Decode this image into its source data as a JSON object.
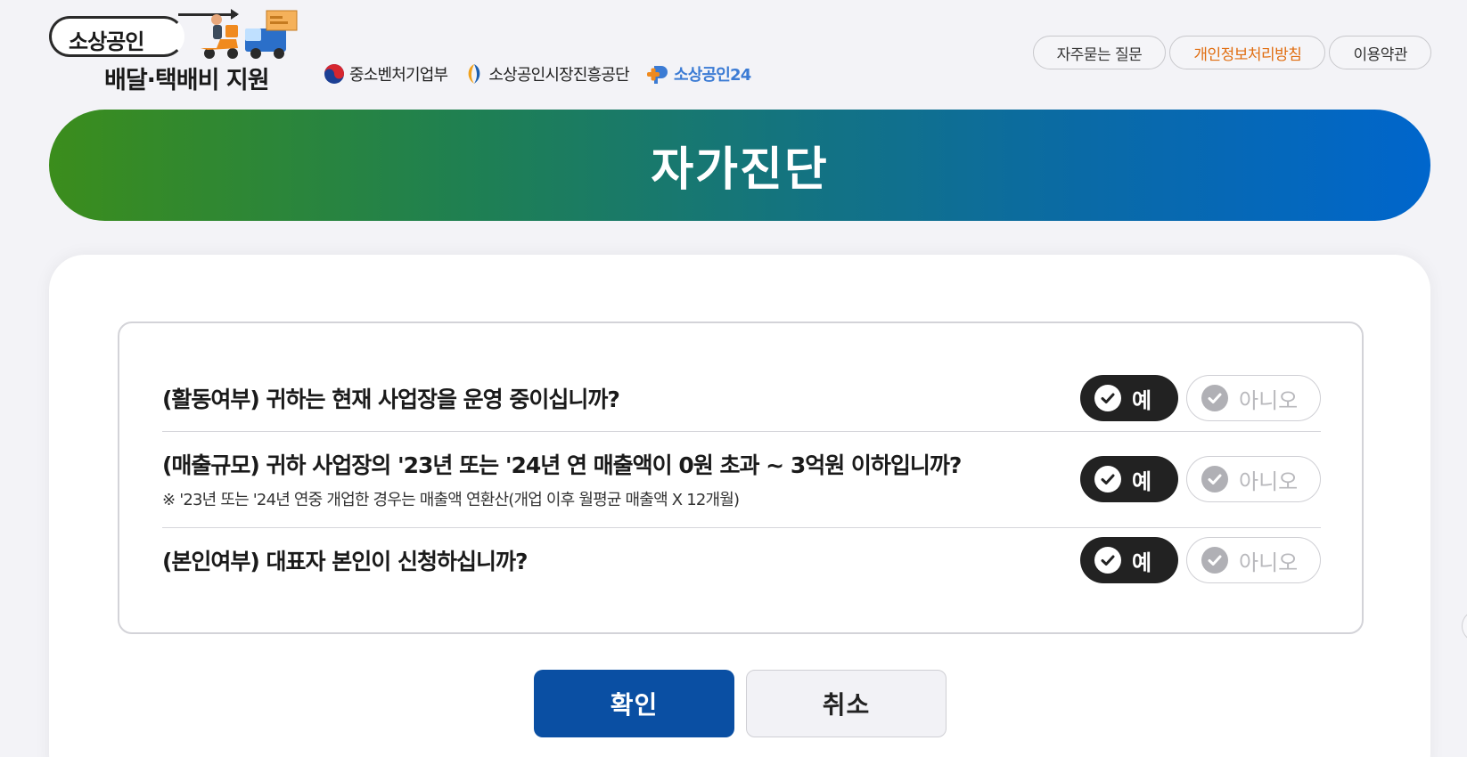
{
  "logo": {
    "line1": "소상공인",
    "line2": "배달·택배비 지원"
  },
  "partners": [
    {
      "label": "중소벤처기업부",
      "icon": "mss-emblem-icon"
    },
    {
      "label": "소상공인시장진흥공단",
      "icon": "semas-logo-icon"
    },
    {
      "label": "소상공인24",
      "icon": "sbiz24-logo-icon"
    }
  ],
  "top_links": [
    {
      "label": "자주묻는 질문"
    },
    {
      "label": "개인정보처리방침",
      "accent": "#e06d10"
    },
    {
      "label": "이용약관"
    }
  ],
  "banner": {
    "title": "자가진단",
    "gradient": [
      "#3b8d1c",
      "#0066cc"
    ]
  },
  "questions": [
    {
      "text": "(활동여부) 귀하는 현재 사업장을 운영 중이십니까?",
      "note": "",
      "yes_label": "예",
      "no_label": "아니오",
      "selected": "yes"
    },
    {
      "text": "(매출규모) 귀하 사업장의 '23년 또는 '24년 연 매출액이 0원 초과 ~ 3억원 이하입니까?",
      "note": "※ '23년 또는 '24년 연중 개업한 경우는 매출액 연환산(개업 이후 월평균 매출액 X 12개월)",
      "yes_label": "예",
      "no_label": "아니오",
      "selected": "yes"
    },
    {
      "text": "(본인여부) 대표자 본인이 신청하십니까?",
      "note": "",
      "yes_label": "예",
      "no_label": "아니오",
      "selected": "yes"
    }
  ],
  "actions": {
    "confirm_label": "확인",
    "cancel_label": "취소",
    "confirm_color": "#0a4fa3"
  }
}
